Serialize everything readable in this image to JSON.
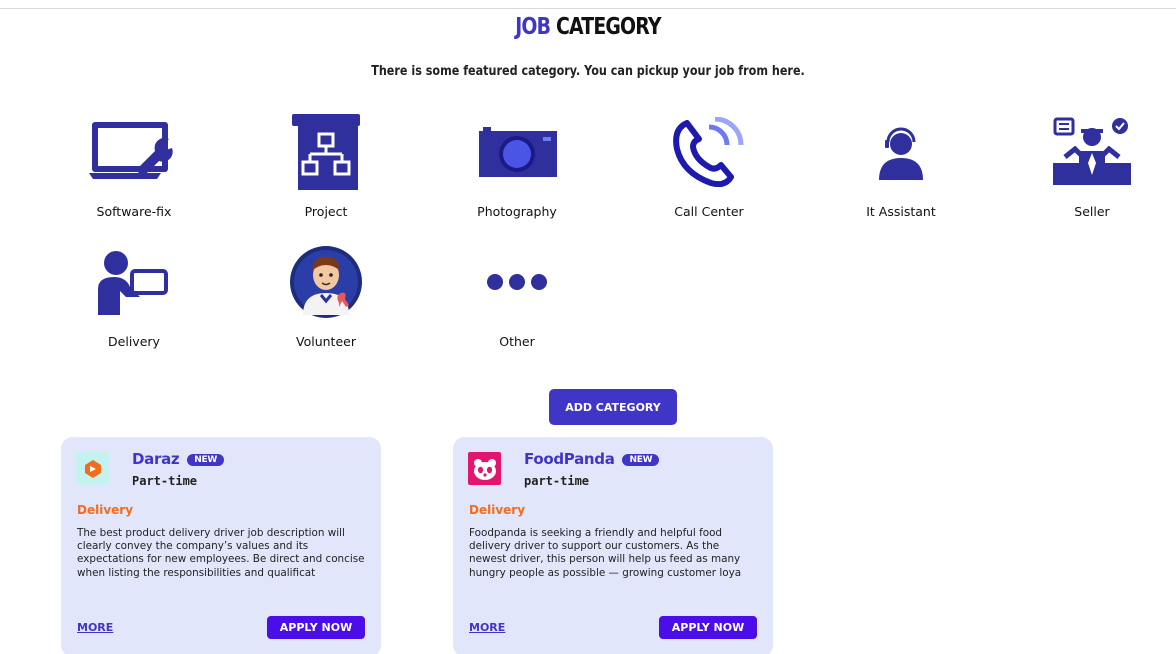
{
  "header": {
    "title_accent": "JOB",
    "title_rest": "CATEGORY",
    "subtitle": "There is some featured category. You can pickup your job from here."
  },
  "categories": [
    {
      "label": "Software-fix",
      "icon": "laptop-wrench-icon"
    },
    {
      "label": "Project",
      "icon": "project-sitemap-icon"
    },
    {
      "label": "Photography",
      "icon": "camera-icon"
    },
    {
      "label": "Call Center",
      "icon": "phone-call-icon"
    },
    {
      "label": "It Assistant",
      "icon": "headset-user-icon"
    },
    {
      "label": "Seller",
      "icon": "seller-icon"
    },
    {
      "label": "Delivery",
      "icon": "delivery-person-icon"
    },
    {
      "label": "Volunteer",
      "icon": "volunteer-avatar-icon"
    },
    {
      "label": "Other",
      "icon": "more-dots-icon"
    }
  ],
  "add_category_label": "ADD CATEGORY",
  "jobs": [
    {
      "company": "Daraz",
      "badge": "NEW",
      "type": "Part-time",
      "category": "Delivery",
      "description": "The best product delivery driver job description will clearly convey the company’s values and its expectations for new employees. Be direct and concise when listing the responsibilities and qualificat",
      "more_label": "MORE",
      "apply_label": "APPLY NOW",
      "logo_icon": "daraz-logo-icon"
    },
    {
      "company": "FoodPanda",
      "badge": "NEW",
      "type": "part-time",
      "category": "Delivery",
      "description": "Foodpanda is seeking a friendly and helpful food delivery driver to support our customers. As the newest driver, this person will help us feed as many hungry people as possible — growing customer loya",
      "more_label": "MORE",
      "apply_label": "APPLY NOW",
      "logo_icon": "foodpanda-logo-icon"
    }
  ],
  "colors": {
    "accent": "#3f36c7",
    "orange": "#f36b1c",
    "apply": "#4b0ee8",
    "card_bg": "#e2e6fb"
  }
}
